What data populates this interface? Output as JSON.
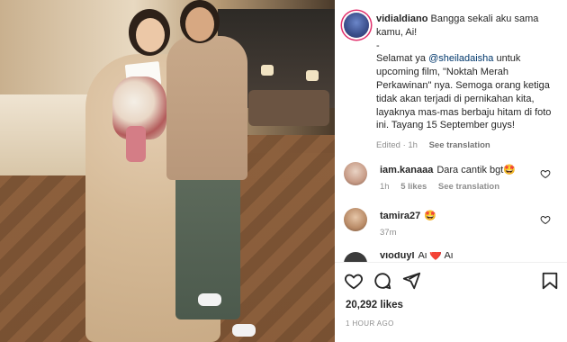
{
  "post": {
    "username": "vidialdiano",
    "caption_line1": "Bangga sekali aku sama kamu, Ai!",
    "caption_dash": "-",
    "caption_p2_before": "Selamat ya ",
    "caption_mention": "@sheiladaisha",
    "caption_p2_after": " untuk upcoming film, \"Noktah Merah Perkawinan\" nya. Semoga orang ketiga tidak akan terjadi di pernikahan kita, layaknya mas-mas berbaju hitam di foto ini. Tayang 15 September guys!",
    "edited_time": "Edited · 1h",
    "see_translation": "See translation"
  },
  "comments": [
    {
      "username": "iam.kanaaa",
      "text": "Dara cantik bgt🤩",
      "time": "1h",
      "likes": "5 likes",
      "see_translation": "See translation"
    },
    {
      "username": "tamira27",
      "text": "🤩",
      "time": "37m"
    },
    {
      "username": "vioduyl",
      "text": "Ai ❤️ Ai"
    }
  ],
  "likes_count": "20,292 likes",
  "timestamp": "1 HOUR AGO",
  "colors": {
    "story_ring": "#e1306c",
    "mention": "#00376b",
    "secondary_text": "#8e8e8e"
  },
  "icons": {
    "like": "heart-icon",
    "comment": "comment-icon",
    "share": "paper-plane-icon",
    "save": "bookmark-icon"
  }
}
